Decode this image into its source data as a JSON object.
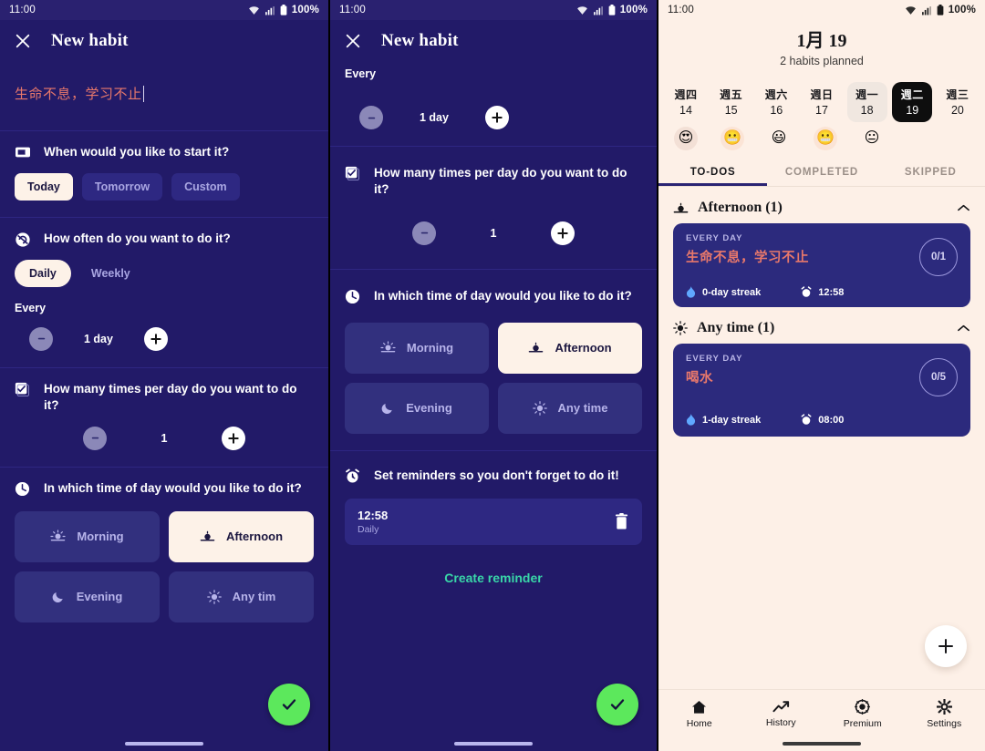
{
  "statusbar": {
    "time": "11:00",
    "battery": "100%"
  },
  "panel1": {
    "appbar": {
      "title": "New habit",
      "close_icon": "close-icon"
    },
    "habit_name": "生命不息，学习不止",
    "start_question": "When would you like to start it?",
    "start_options": [
      "Today",
      "Tomorrow",
      "Custom"
    ],
    "start_selected": "Today",
    "often_question": "How often do you want to do it?",
    "often_options": [
      "Daily",
      "Weekly"
    ],
    "often_selected": "Daily",
    "every_label": "Every",
    "every_value": "1 day",
    "times_question": "How many times per day do you want to do it?",
    "times_value": "1",
    "timeofday_question": "In which time of day would you like to do it?",
    "timeofday_options": [
      "Morning",
      "Afternoon",
      "Evening",
      "Any tim"
    ],
    "timeofday_selected": "Afternoon"
  },
  "panel2": {
    "appbar": {
      "title": "New habit",
      "close_icon": "close-icon"
    },
    "every_label": "Every",
    "every_value": "1 day",
    "times_question": "How many times per day do you want to do it?",
    "times_value": "1",
    "timeofday_question": "In which time of day would you like to do it?",
    "timeofday_options": [
      "Morning",
      "Afternoon",
      "Evening",
      "Any time"
    ],
    "timeofday_selected": "Afternoon",
    "reminders_question": "Set reminders so you don't forget to do it!",
    "reminder": {
      "time": "12:58",
      "repeat": "Daily",
      "delete_icon": "trash-icon"
    },
    "create_reminder": "Create reminder"
  },
  "panel3": {
    "date_title": "1月 19",
    "planned": "2 habits planned",
    "days": [
      {
        "name": "週四",
        "num": "14",
        "state": "past"
      },
      {
        "name": "週五",
        "num": "15",
        "state": "past"
      },
      {
        "name": "週六",
        "num": "16",
        "state": "past"
      },
      {
        "name": "週日",
        "num": "17",
        "state": "past"
      },
      {
        "name": "週一",
        "num": "18",
        "state": "yest"
      },
      {
        "name": "週二",
        "num": "19",
        "state": "today"
      },
      {
        "name": "週三",
        "num": "20",
        "state": "future"
      }
    ],
    "moods": [
      {
        "glyph": "😍",
        "name": "add-mood",
        "bg": "#f7e6dd",
        "fg": "#6d4a4a"
      },
      {
        "glyph": "😬",
        "name": "grimacing-mood",
        "bg": "#fbe4d6",
        "fg": "#000"
      },
      {
        "glyph": "😃",
        "name": "grinning-mood",
        "bg": "#fdf0e7",
        "fg": "#000"
      },
      {
        "glyph": "😬",
        "name": "grimacing-mood",
        "bg": "#fbe4d6",
        "fg": "#000"
      },
      {
        "glyph": "😐",
        "name": "neutral-mood",
        "bg": "#fdf0e7",
        "fg": "#000"
      }
    ],
    "tabs": [
      "TO-DOS",
      "COMPLETED",
      "SKIPPED"
    ],
    "tab_selected": "TO-DOS",
    "groups": [
      {
        "title": "Afternoon (1)",
        "icon": "afternoon-icon",
        "habits": [
          {
            "freq": "EVERY DAY",
            "name": "生命不息，学习不止",
            "progress": "0/1",
            "streak": "0-day streak",
            "time": "12:58"
          }
        ]
      },
      {
        "title": "Any time (1)",
        "icon": "anytime-icon",
        "habits": [
          {
            "freq": "EVERY DAY",
            "name": "喝水",
            "progress": "0/5",
            "streak": "1-day streak",
            "time": "08:00"
          }
        ]
      }
    ],
    "bottomnav": [
      {
        "label": "Home",
        "icon": "home-icon"
      },
      {
        "label": "History",
        "icon": "trending-up-icon"
      },
      {
        "label": "Premium",
        "icon": "medal-icon"
      },
      {
        "label": "Settings",
        "icon": "gear-icon"
      }
    ]
  },
  "colors": {
    "navy": "#221a68",
    "card": "#2c2a7d",
    "cream": "#fdf0e7",
    "accent_coral": "#e8786b",
    "green": "#5ce85c",
    "teal": "#39d6a8"
  }
}
